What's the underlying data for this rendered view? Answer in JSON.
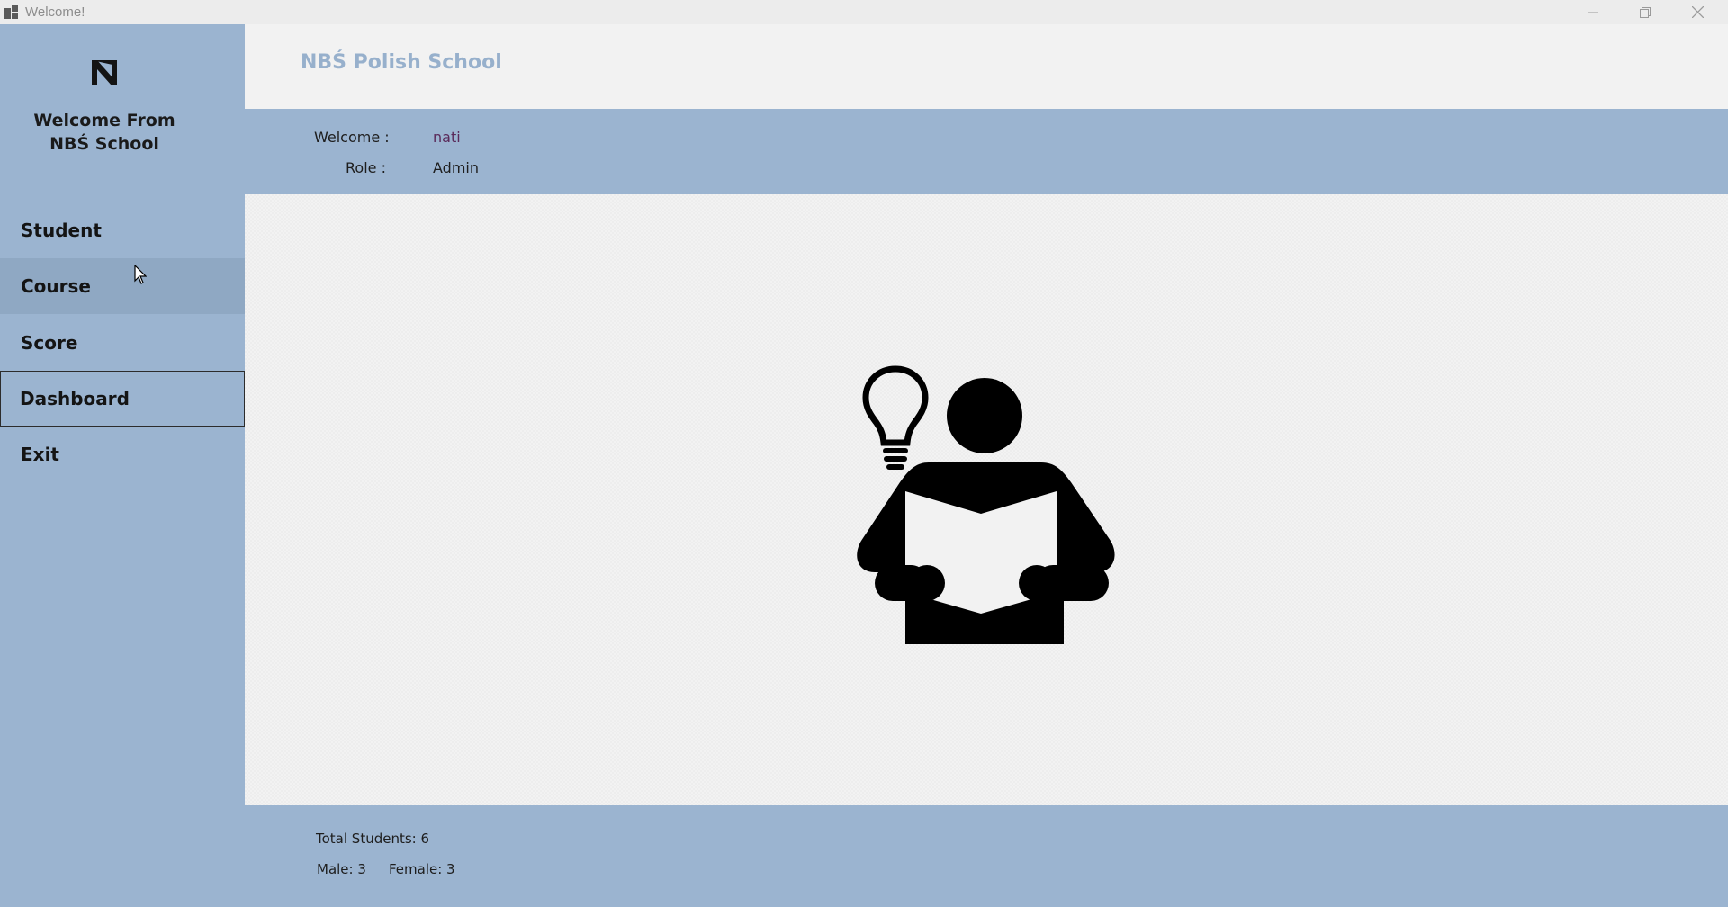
{
  "window": {
    "title": "Welcome!",
    "icons": {
      "app": "app-window-icon",
      "minimize": "minimize-icon",
      "restore": "restore-icon",
      "close": "close-icon"
    }
  },
  "sidebar": {
    "logo_icon": "n-logo-icon",
    "welcome_line1": "Welcome From",
    "welcome_line2": "NBŚ School",
    "items": [
      {
        "label": "Student"
      },
      {
        "label": "Course"
      },
      {
        "label": "Score"
      },
      {
        "label": "Dashboard"
      },
      {
        "label": "Exit"
      }
    ],
    "hovered_item": "Course",
    "active_item": "Dashboard"
  },
  "header": {
    "brand": "NBŚ Polish School"
  },
  "user_info": {
    "welcome_label": "Welcome :",
    "welcome_value": "nati",
    "role_label": "Role :",
    "role_value": "Admin"
  },
  "main": {
    "illustration_icon": "student-reading-lightbulb-icon"
  },
  "stats": {
    "total_students": "Total Students: 6",
    "male": "Male: 3",
    "female": "Female: 3"
  },
  "colors": {
    "sidebar_bg": "#9bb4d0",
    "hover_bg": "#8fa8c3",
    "brand_text": "#97b0cc",
    "welcome_value_text": "#5a2a5a",
    "panel_bg": "#f2f2f2"
  }
}
